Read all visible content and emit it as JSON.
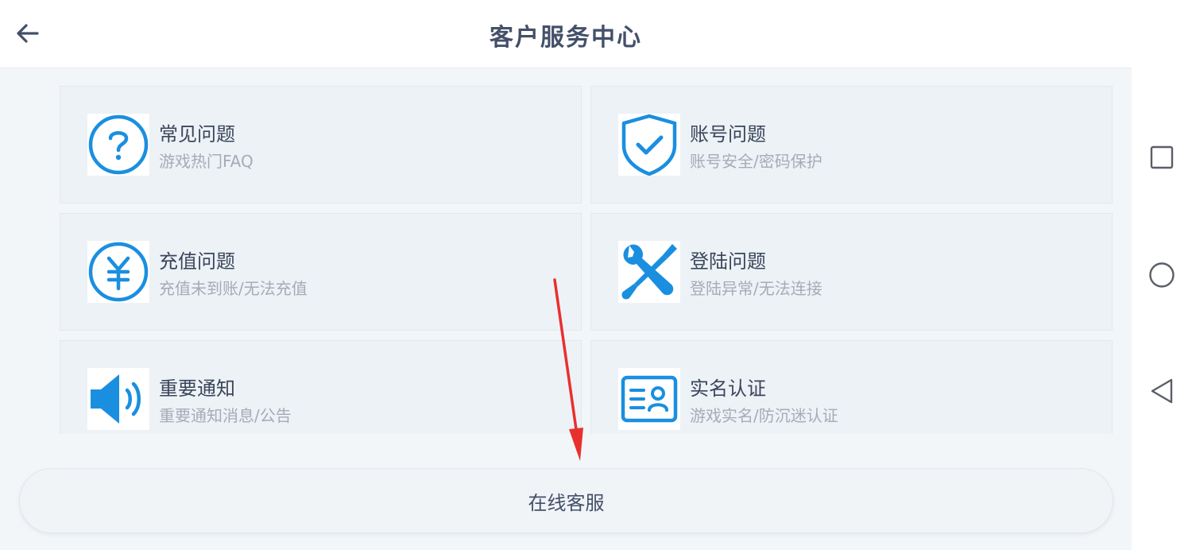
{
  "header": {
    "title": "客户服务中心"
  },
  "cards": [
    {
      "title": "常见问题",
      "subtitle": "游戏热门FAQ",
      "icon": "question-circle-icon"
    },
    {
      "title": "账号问题",
      "subtitle": "账号安全/密码保护",
      "icon": "shield-check-icon"
    },
    {
      "title": "充值问题",
      "subtitle": "充值未到账/无法充值",
      "icon": "yen-circle-icon"
    },
    {
      "title": "登陆问题",
      "subtitle": "登陆异常/无法连接",
      "icon": "wrench-screwdriver-icon"
    },
    {
      "title": "重要通知",
      "subtitle": "重要通知消息/公告",
      "icon": "speaker-icon"
    },
    {
      "title": "实名认证",
      "subtitle": "游戏实名/防沉迷认证",
      "icon": "id-card-icon"
    }
  ],
  "service_button": {
    "label": "在线客服"
  },
  "colors": {
    "accent": "#1a8fe0",
    "annotation_arrow": "#e8302e"
  },
  "system_nav": [
    "recent-apps-icon",
    "home-icon",
    "back-icon"
  ]
}
